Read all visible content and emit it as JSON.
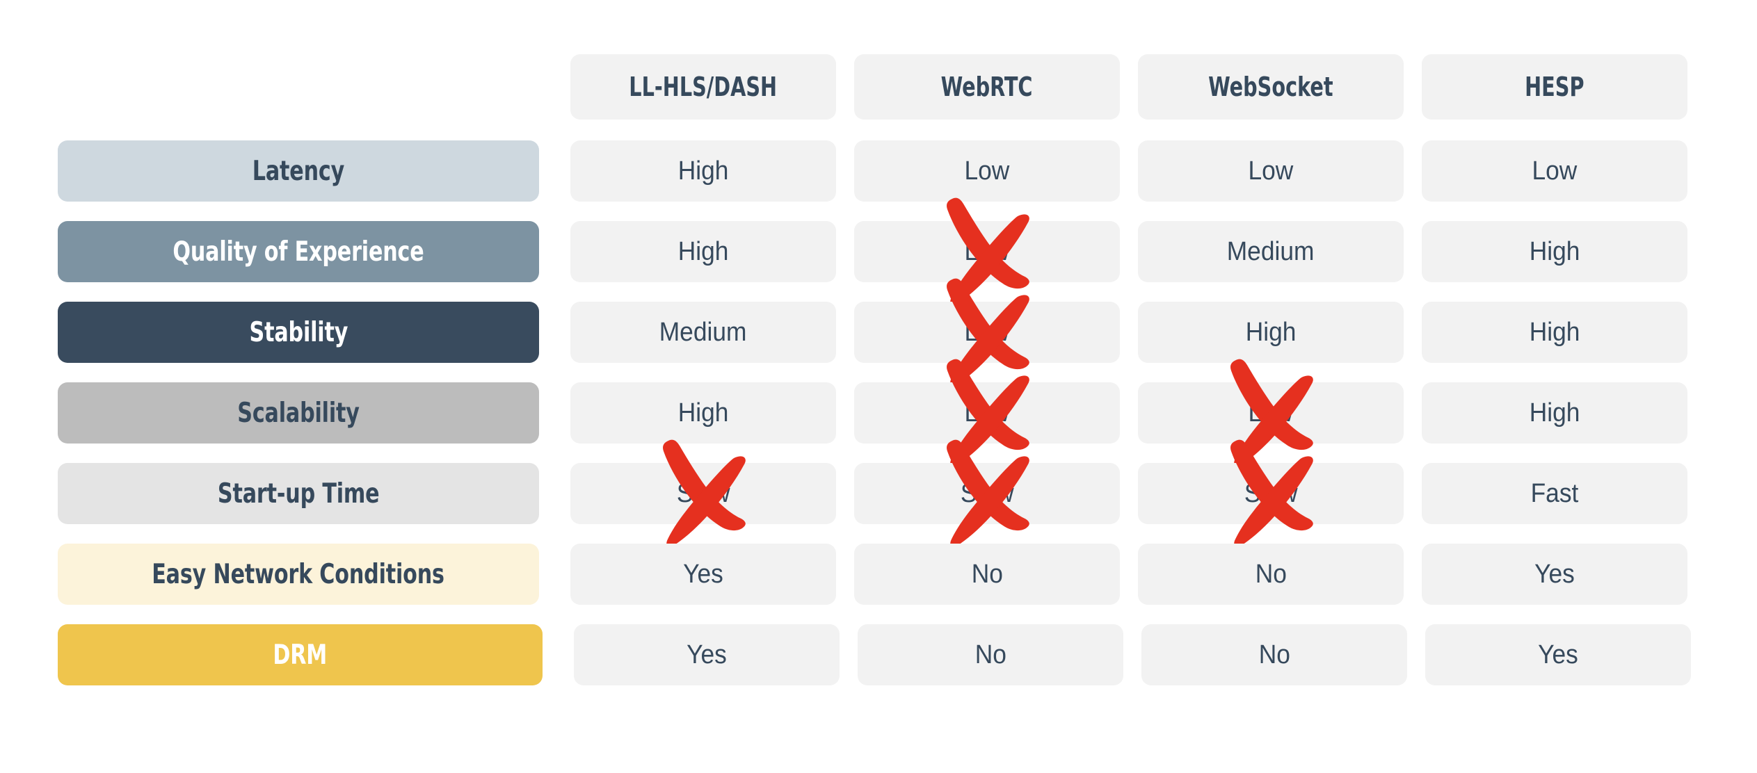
{
  "table": {
    "corner_label": "",
    "columns": [
      {
        "label": "LL-HLS/DASH"
      },
      {
        "label": "WebRTC"
      },
      {
        "label": "WebSocket"
      },
      {
        "label": "HESP"
      }
    ],
    "rows": [
      {
        "label": "Latency",
        "label_bg": "#ced8df",
        "label_color": "#36495c",
        "values": [
          "High",
          "Low",
          "Low",
          "Low"
        ],
        "crossed": [
          false,
          false,
          false,
          false
        ]
      },
      {
        "label": "Quality of Experience",
        "label_bg": "#7d93a2",
        "label_color": "#ffffff",
        "values": [
          "High",
          "Low",
          "Medium",
          "High"
        ],
        "crossed": [
          false,
          true,
          false,
          false
        ]
      },
      {
        "label": "Stability",
        "label_bg": "#394b5e",
        "label_color": "#ffffff",
        "values": [
          "Medium",
          "Low",
          "High",
          "High"
        ],
        "crossed": [
          false,
          true,
          false,
          false
        ]
      },
      {
        "label": "Scalability",
        "label_bg": "#bcbcbc",
        "label_color": "#36495c",
        "values": [
          "High",
          "Low",
          "Low",
          "High"
        ],
        "crossed": [
          false,
          true,
          true,
          false
        ]
      },
      {
        "label": "Start-up Time",
        "label_bg": "#e4e4e4",
        "label_color": "#36495c",
        "values": [
          "Slow",
          "Slow",
          "Slow",
          "Fast"
        ],
        "crossed": [
          true,
          true,
          true,
          false
        ]
      },
      {
        "label": "Easy Network Conditions",
        "label_bg": "#fcf3da",
        "label_color": "#36495c",
        "values": [
          "Yes",
          "No",
          "No",
          "Yes"
        ],
        "crossed": [
          false,
          false,
          false,
          false
        ]
      },
      {
        "label": "DRM",
        "label_bg": "#efc54d",
        "label_color": "#ffffff",
        "values": [
          "Yes",
          "No",
          "No",
          "Yes"
        ],
        "crossed": [
          false,
          false,
          false,
          false
        ]
      }
    ]
  },
  "theme": {
    "page_bg": "#ffffff",
    "cell_bg": "#f2f2f2",
    "header_bg": "#f2f2f2",
    "text_dark": "#36495c",
    "cross_red": "#e5301f"
  },
  "icons": {
    "cross": "red-cross-icon"
  }
}
